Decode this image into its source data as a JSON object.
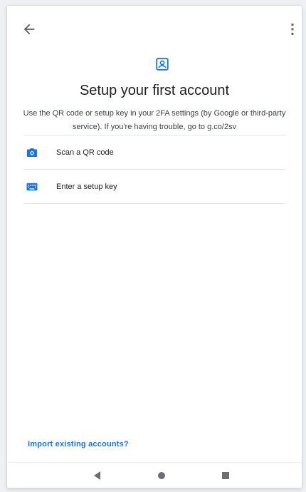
{
  "colors": {
    "accent": "#1a73e8",
    "text": "#202124",
    "divider": "#e3e5e8"
  },
  "header": {
    "back_icon": "arrow-back-icon",
    "menu_icon": "more-vert-icon"
  },
  "main": {
    "icon": "account-box-icon",
    "title": "Setup your first account",
    "description": "Use the QR code or setup key in your 2FA settings (by Google or third-party service). If you're having trouble, go to g.co/2sv",
    "options": [
      {
        "icon": "camera-icon",
        "label": "Scan a QR code"
      },
      {
        "icon": "keyboard-icon",
        "label": "Enter a setup key"
      }
    ]
  },
  "footer": {
    "import_link": "Import existing accounts?"
  },
  "navbar": {
    "back": "nav-back-icon",
    "home": "nav-home-icon",
    "recents": "nav-recents-icon"
  }
}
